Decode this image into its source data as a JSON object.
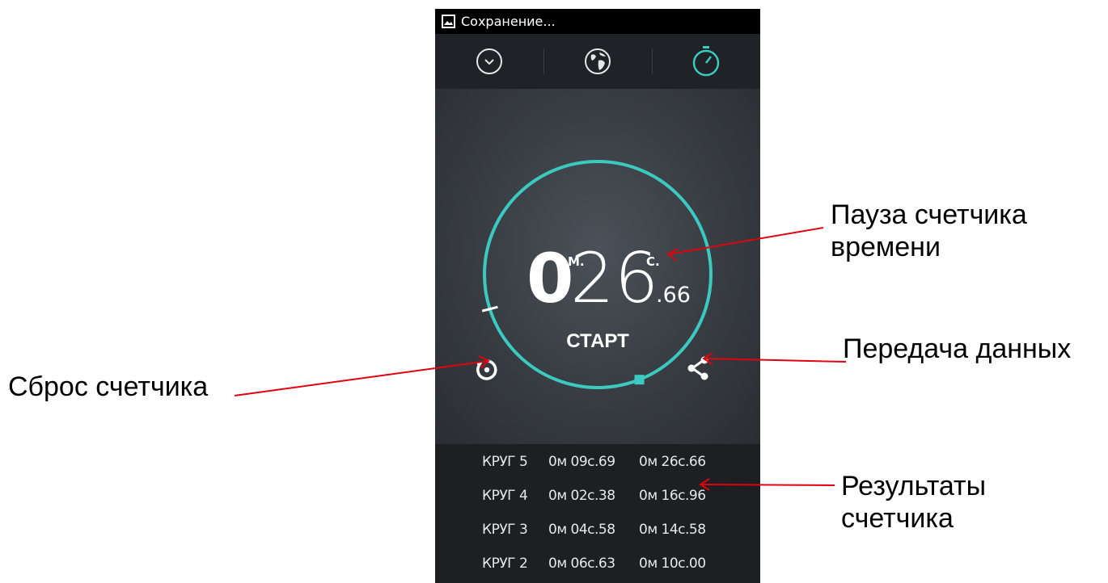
{
  "status_bar": {
    "icon": "image-icon",
    "text": "Сохранение..."
  },
  "tabs": [
    {
      "icon": "clock-icon",
      "active": false
    },
    {
      "icon": "globe-icon",
      "active": false
    },
    {
      "icon": "stopwatch-icon",
      "active": true
    }
  ],
  "stopwatch": {
    "minutes": "0",
    "minutes_unit": "М.",
    "seconds": "26",
    "seconds_unit": "С.",
    "hundredths": ".66",
    "start_label": "СТАРТ",
    "progress_fraction": 0.44,
    "accent_color": "#3cc9c0"
  },
  "reset_icon": "reset-icon",
  "share_icon": "share-icon",
  "laps": [
    {
      "name": "КРУГ 5",
      "lap_time": "0м 09с.69",
      "total": "0м 26с.66"
    },
    {
      "name": "КРУГ 4",
      "lap_time": "0м 02с.38",
      "total": "0м 16с.96"
    },
    {
      "name": "КРУГ 3",
      "lap_time": "0м 04с.58",
      "total": "0м 14с.58"
    },
    {
      "name": "КРУГ 2",
      "lap_time": "0м 06с.63",
      "total": "0м 10с.00"
    }
  ],
  "annotations": {
    "pause": "Пауза счетчика\nвремени",
    "share": "Передача данных",
    "reset": "Сброс счетчика",
    "results": "Результаты\nсчетчика",
    "arrow_color": "#e0000f"
  }
}
